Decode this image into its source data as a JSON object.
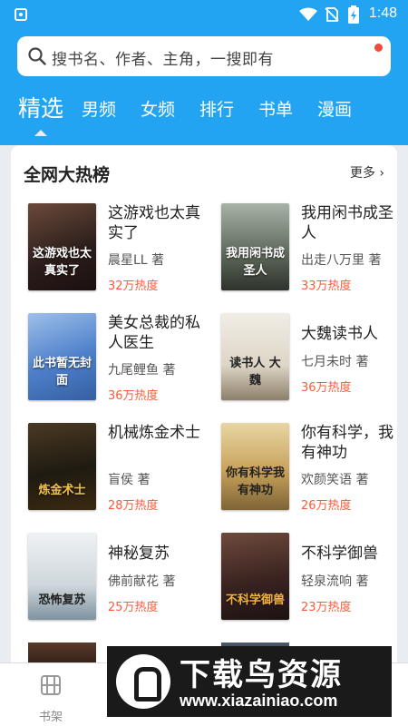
{
  "status_bar": {
    "time": "1:48"
  },
  "search": {
    "placeholder": "搜书名、作者、主角，一搜即有"
  },
  "tabs": [
    {
      "label": "精选",
      "active": true
    },
    {
      "label": "男频"
    },
    {
      "label": "女频"
    },
    {
      "label": "排行"
    },
    {
      "label": "书单"
    },
    {
      "label": "漫画"
    }
  ],
  "ranking": {
    "title": "全网大热榜",
    "more_label": "更多",
    "books": [
      {
        "title": "这游戏也太真实了",
        "author": "晨星LL 著",
        "heat": "32万热度",
        "cover_text": "这游戏也太真实了",
        "cover_color": "#3b2a2a"
      },
      {
        "title": "我用闲书成圣人",
        "author": "出走八万里 著",
        "heat": "33万热度",
        "cover_text": "我用闲书成圣人",
        "cover_color": "#6f7a6c"
      },
      {
        "title": "美女总裁的私人医生",
        "author": "九尾鲤鱼 著",
        "heat": "36万热度",
        "cover_text": "此书暂无封面",
        "cover_color": "#5a8ad0"
      },
      {
        "title": "大魏读书人",
        "author": "七月未时 著",
        "heat": "36万热度",
        "cover_text": "读书人 大魏",
        "cover_color": "#e9e3d8"
      },
      {
        "title": "机械炼金术士",
        "author": "盲侯 著",
        "heat": "28万热度",
        "cover_text": "炼金术士",
        "cover_color": "#2b2418"
      },
      {
        "title": "你有科学，我有神功",
        "author": "欢颜笑语 著",
        "heat": "26万热度",
        "cover_text": "你有科学我有神功",
        "cover_color": "#c9a25a"
      },
      {
        "title": "神秘复苏",
        "author": "佛前献花 著",
        "heat": "25万热度",
        "cover_text": "恐怖复苏",
        "cover_color": "#cfd7dc"
      },
      {
        "title": "不科学御兽",
        "author": "轻泉流响 著",
        "heat": "23万热度",
        "cover_text": "不科学御兽",
        "cover_color": "#4a2a24"
      }
    ]
  },
  "bottom_nav": {
    "shelf_label": "书架"
  },
  "watermark": {
    "title": "下载鸟资源",
    "url": "www.xiazainiao.com"
  },
  "colors": {
    "brand_blue": "#22a4f2",
    "heat_red": "#ff5a3b"
  }
}
